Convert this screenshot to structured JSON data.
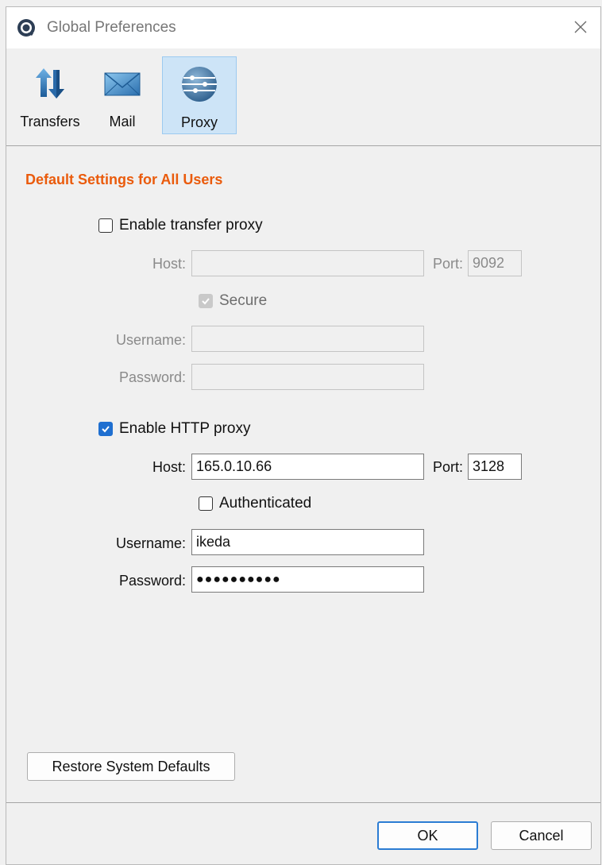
{
  "window": {
    "title": "Global Preferences",
    "app_icon": "app-logo-icon",
    "close_icon": "close-icon"
  },
  "toolbar": {
    "tabs": [
      {
        "label": "Transfers",
        "icon": "transfer-arrows-icon",
        "active": false
      },
      {
        "label": "Mail",
        "icon": "mail-envelope-icon",
        "active": false
      },
      {
        "label": "Proxy",
        "icon": "proxy-globe-icon",
        "active": true
      }
    ]
  },
  "section": {
    "title": "Default Settings for All Users"
  },
  "transfer_proxy": {
    "enable_label": "Enable transfer proxy",
    "enabled": false,
    "host_label": "Host:",
    "host_value": "",
    "port_label": "Port:",
    "port_value": "9092",
    "secure_label": "Secure",
    "secure_checked": true,
    "username_label": "Username:",
    "username_value": "",
    "password_label": "Password:",
    "password_value": ""
  },
  "http_proxy": {
    "enable_label": "Enable HTTP proxy",
    "enabled": true,
    "host_label": "Host:",
    "host_value": "165.0.10.66",
    "port_label": "Port:",
    "port_value": "3128",
    "authenticated_label": "Authenticated",
    "authenticated_checked": false,
    "username_label": "Username:",
    "username_value": "ikeda",
    "password_label": "Password:",
    "password_value": "●●●●●●●●●●"
  },
  "buttons": {
    "restore_label": "Restore System Defaults",
    "ok_label": "OK",
    "cancel_label": "Cancel"
  },
  "colors": {
    "accent": "#1f6fd0",
    "section_title": "#ea5b0c",
    "active_tab_bg": "#cde4f7"
  }
}
